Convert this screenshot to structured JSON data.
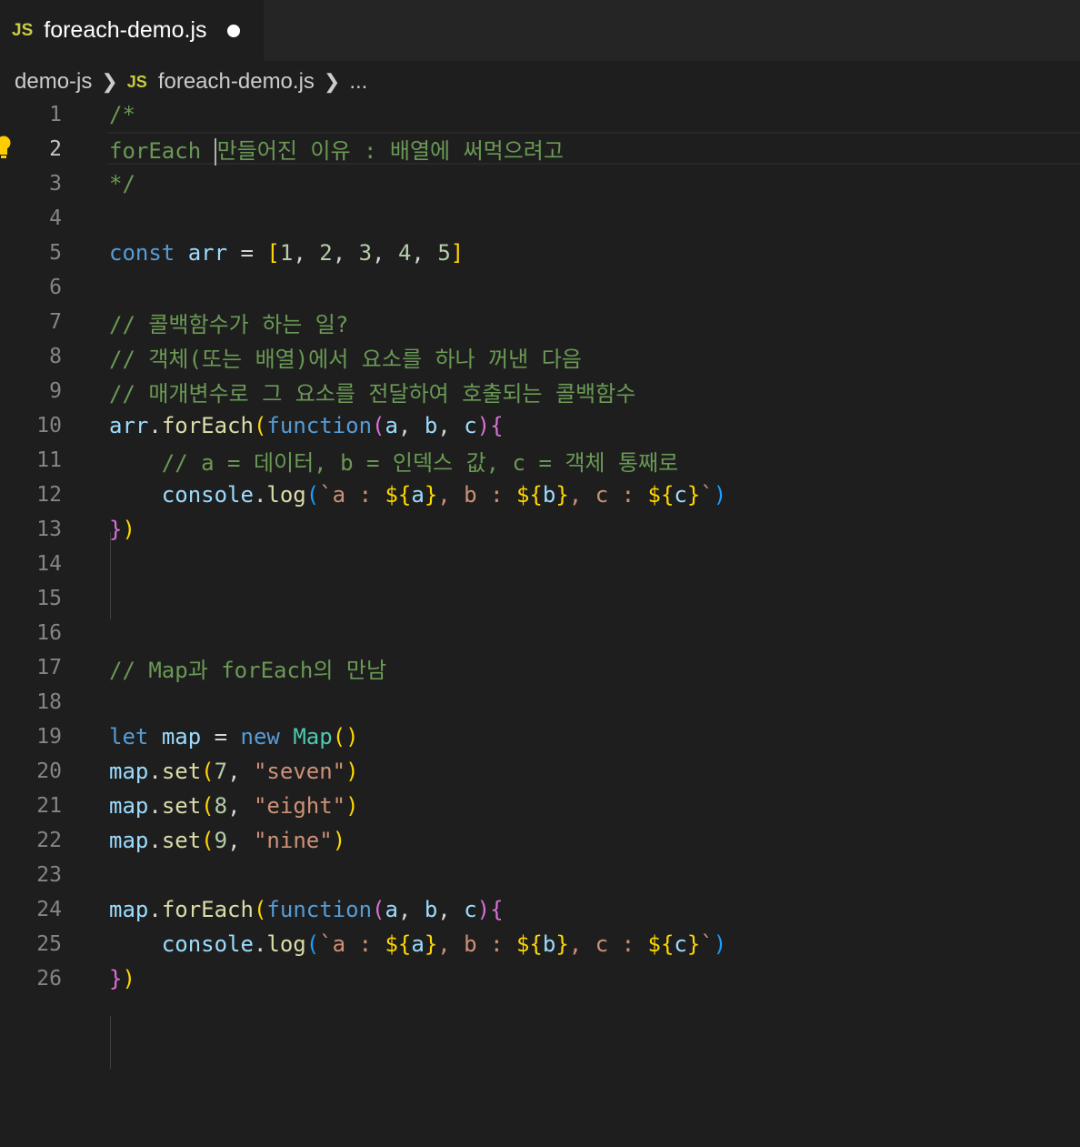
{
  "tab": {
    "badge": "JS",
    "title": "foreach-demo.js"
  },
  "breadcrumb": {
    "folder": "demo-js",
    "badge": "JS",
    "file": "foreach-demo.js",
    "more": "..."
  },
  "editor": {
    "active_line": 2,
    "line_numbers": [
      "1",
      "2",
      "3",
      "4",
      "5",
      "6",
      "7",
      "8",
      "9",
      "10",
      "11",
      "12",
      "13",
      "14",
      "15",
      "16",
      "17",
      "18",
      "19",
      "20",
      "21",
      "22",
      "23",
      "24",
      "25",
      "26"
    ],
    "lines": [
      [
        {
          "t": "/*",
          "c": "comment"
        }
      ],
      [
        {
          "t": "forEach ",
          "c": "comment"
        },
        {
          "cursor": true
        },
        {
          "t": "만들어진 이유 : 배열에 써먹으려고",
          "c": "comment"
        }
      ],
      [
        {
          "t": "*/",
          "c": "comment"
        }
      ],
      [],
      [
        {
          "t": "const",
          "c": "kw"
        },
        {
          "t": " ",
          "c": "plain"
        },
        {
          "t": "arr",
          "c": "var"
        },
        {
          "t": " = ",
          "c": "plain"
        },
        {
          "t": "[",
          "c": "b1"
        },
        {
          "t": "1",
          "c": "num"
        },
        {
          "t": ", ",
          "c": "plain"
        },
        {
          "t": "2",
          "c": "num"
        },
        {
          "t": ", ",
          "c": "plain"
        },
        {
          "t": "3",
          "c": "num"
        },
        {
          "t": ", ",
          "c": "plain"
        },
        {
          "t": "4",
          "c": "num"
        },
        {
          "t": ", ",
          "c": "plain"
        },
        {
          "t": "5",
          "c": "num"
        },
        {
          "t": "]",
          "c": "b1"
        }
      ],
      [],
      [
        {
          "t": "// 콜백함수가 하는 일?",
          "c": "comment"
        }
      ],
      [
        {
          "t": "// 객체(또는 배열)에서 요소를 하나 꺼낸 다음",
          "c": "comment"
        }
      ],
      [
        {
          "t": "// 매개변수로 그 요소를 전달하여 호출되는 콜백함수",
          "c": "comment"
        }
      ],
      [
        {
          "t": "arr",
          "c": "var"
        },
        {
          "t": ".",
          "c": "plain"
        },
        {
          "t": "forEach",
          "c": "fn"
        },
        {
          "t": "(",
          "c": "b1"
        },
        {
          "t": "function",
          "c": "kw"
        },
        {
          "t": "(",
          "c": "b2"
        },
        {
          "t": "a",
          "c": "var"
        },
        {
          "t": ", ",
          "c": "plain"
        },
        {
          "t": "b",
          "c": "var"
        },
        {
          "t": ", ",
          "c": "plain"
        },
        {
          "t": "c",
          "c": "var"
        },
        {
          "t": ")",
          "c": "b2"
        },
        {
          "t": "{",
          "c": "b2"
        }
      ],
      [
        {
          "t": "    ",
          "c": "plain"
        },
        {
          "t": "// a = 데이터, b = 인덱스 값, c = 객체 통째로",
          "c": "comment"
        }
      ],
      [
        {
          "t": "    ",
          "c": "plain"
        },
        {
          "t": "console",
          "c": "var"
        },
        {
          "t": ".",
          "c": "plain"
        },
        {
          "t": "log",
          "c": "fn"
        },
        {
          "t": "(",
          "c": "b3"
        },
        {
          "t": "`a : ",
          "c": "str"
        },
        {
          "t": "${",
          "c": "b1"
        },
        {
          "t": "a",
          "c": "var"
        },
        {
          "t": "}",
          "c": "b1"
        },
        {
          "t": ", b : ",
          "c": "str"
        },
        {
          "t": "${",
          "c": "b1"
        },
        {
          "t": "b",
          "c": "var"
        },
        {
          "t": "}",
          "c": "b1"
        },
        {
          "t": ", c : ",
          "c": "str"
        },
        {
          "t": "${",
          "c": "b1"
        },
        {
          "t": "c",
          "c": "var"
        },
        {
          "t": "}",
          "c": "b1"
        },
        {
          "t": "`",
          "c": "str"
        },
        {
          "t": ")",
          "c": "b3"
        }
      ],
      [
        {
          "t": "}",
          "c": "b2"
        },
        {
          "t": ")",
          "c": "b1"
        }
      ],
      [],
      [],
      [],
      [
        {
          "t": "// Map과 forEach의 만남",
          "c": "comment"
        }
      ],
      [],
      [
        {
          "t": "let",
          "c": "kw"
        },
        {
          "t": " ",
          "c": "plain"
        },
        {
          "t": "map",
          "c": "var"
        },
        {
          "t": " = ",
          "c": "plain"
        },
        {
          "t": "new",
          "c": "kw"
        },
        {
          "t": " ",
          "c": "plain"
        },
        {
          "t": "Map",
          "c": "class"
        },
        {
          "t": "()",
          "c": "b1"
        }
      ],
      [
        {
          "t": "map",
          "c": "var"
        },
        {
          "t": ".",
          "c": "plain"
        },
        {
          "t": "set",
          "c": "fn"
        },
        {
          "t": "(",
          "c": "b1"
        },
        {
          "t": "7",
          "c": "num"
        },
        {
          "t": ", ",
          "c": "plain"
        },
        {
          "t": "\"seven\"",
          "c": "str"
        },
        {
          "t": ")",
          "c": "b1"
        }
      ],
      [
        {
          "t": "map",
          "c": "var"
        },
        {
          "t": ".",
          "c": "plain"
        },
        {
          "t": "set",
          "c": "fn"
        },
        {
          "t": "(",
          "c": "b1"
        },
        {
          "t": "8",
          "c": "num"
        },
        {
          "t": ", ",
          "c": "plain"
        },
        {
          "t": "\"eight\"",
          "c": "str"
        },
        {
          "t": ")",
          "c": "b1"
        }
      ],
      [
        {
          "t": "map",
          "c": "var"
        },
        {
          "t": ".",
          "c": "plain"
        },
        {
          "t": "set",
          "c": "fn"
        },
        {
          "t": "(",
          "c": "b1"
        },
        {
          "t": "9",
          "c": "num"
        },
        {
          "t": ", ",
          "c": "plain"
        },
        {
          "t": "\"nine\"",
          "c": "str"
        },
        {
          "t": ")",
          "c": "b1"
        }
      ],
      [],
      [
        {
          "t": "map",
          "c": "var"
        },
        {
          "t": ".",
          "c": "plain"
        },
        {
          "t": "forEach",
          "c": "fn"
        },
        {
          "t": "(",
          "c": "b1"
        },
        {
          "t": "function",
          "c": "kw"
        },
        {
          "t": "(",
          "c": "b2"
        },
        {
          "t": "a",
          "c": "var"
        },
        {
          "t": ", ",
          "c": "plain"
        },
        {
          "t": "b",
          "c": "var"
        },
        {
          "t": ", ",
          "c": "plain"
        },
        {
          "t": "c",
          "c": "var"
        },
        {
          "t": ")",
          "c": "b2"
        },
        {
          "t": "{",
          "c": "b2"
        }
      ],
      [
        {
          "t": "    ",
          "c": "plain"
        },
        {
          "t": "console",
          "c": "var"
        },
        {
          "t": ".",
          "c": "plain"
        },
        {
          "t": "log",
          "c": "fn"
        },
        {
          "t": "(",
          "c": "b3"
        },
        {
          "t": "`a : ",
          "c": "str"
        },
        {
          "t": "${",
          "c": "b1"
        },
        {
          "t": "a",
          "c": "var"
        },
        {
          "t": "}",
          "c": "b1"
        },
        {
          "t": ", b : ",
          "c": "str"
        },
        {
          "t": "${",
          "c": "b1"
        },
        {
          "t": "b",
          "c": "var"
        },
        {
          "t": "}",
          "c": "b1"
        },
        {
          "t": ", c : ",
          "c": "str"
        },
        {
          "t": "${",
          "c": "b1"
        },
        {
          "t": "c",
          "c": "var"
        },
        {
          "t": "}",
          "c": "b1"
        },
        {
          "t": "`",
          "c": "str"
        },
        {
          "t": ")",
          "c": "b3"
        }
      ],
      [
        {
          "t": "}",
          "c": "b2"
        },
        {
          "t": ")",
          "c": "b1"
        }
      ]
    ]
  },
  "colors": {
    "background": "#1e1e1e",
    "tabbar": "#252526",
    "comment": "#6a9955",
    "keyword": "#569cd6",
    "variable": "#9cdcfe",
    "function": "#dcdcaa",
    "number": "#b5cea8",
    "string": "#ce9178",
    "class": "#4ec9b0",
    "lightbulb": "#ffcc00"
  },
  "icons": {
    "lightbulb": "lightbulb-icon",
    "dirty": "unsaved-dot-icon",
    "chevron": "chevron-right-icon"
  }
}
